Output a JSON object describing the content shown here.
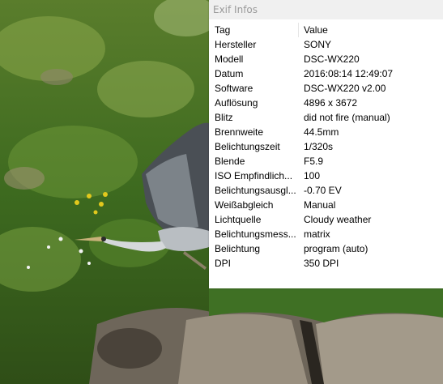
{
  "window": {
    "title": "Exif Infos"
  },
  "table": {
    "headers": {
      "tag": "Tag",
      "value": "Value"
    },
    "rows": [
      {
        "tag": "Hersteller",
        "value": "SONY"
      },
      {
        "tag": "Modell",
        "value": "DSC-WX220"
      },
      {
        "tag": "Datum",
        "value": "2016:08:14 12:49:07"
      },
      {
        "tag": "Software",
        "value": "DSC-WX220 v2.00"
      },
      {
        "tag": "Auflösung",
        "value": "4896 x 3672"
      },
      {
        "tag": "Blitz",
        "value": "did not fire (manual)"
      },
      {
        "tag": "Brennweite",
        "value": "44.5mm"
      },
      {
        "tag": "Belichtungszeit",
        "value": "1/320s"
      },
      {
        "tag": "Blende",
        "value": "F5.9"
      },
      {
        "tag": "ISO Empfindlich...",
        "value": "100"
      },
      {
        "tag": "Belichtungsausgl...",
        "value": "-0.70 EV"
      },
      {
        "tag": "Weißabgleich",
        "value": "Manual"
      },
      {
        "tag": "Lichtquelle",
        "value": "Cloudy weather"
      },
      {
        "tag": "Belichtungsmess...",
        "value": "matrix"
      },
      {
        "tag": "Belichtung",
        "value": "program (auto)"
      },
      {
        "tag": "DPI",
        "value": "350 DPI"
      }
    ]
  },
  "colors": {
    "panel_background": "#ffffff",
    "title_bar": "#f0f0f0",
    "title_text": "#9a9a9a",
    "grass": "#3f6b22",
    "stone": "#8a8276"
  }
}
